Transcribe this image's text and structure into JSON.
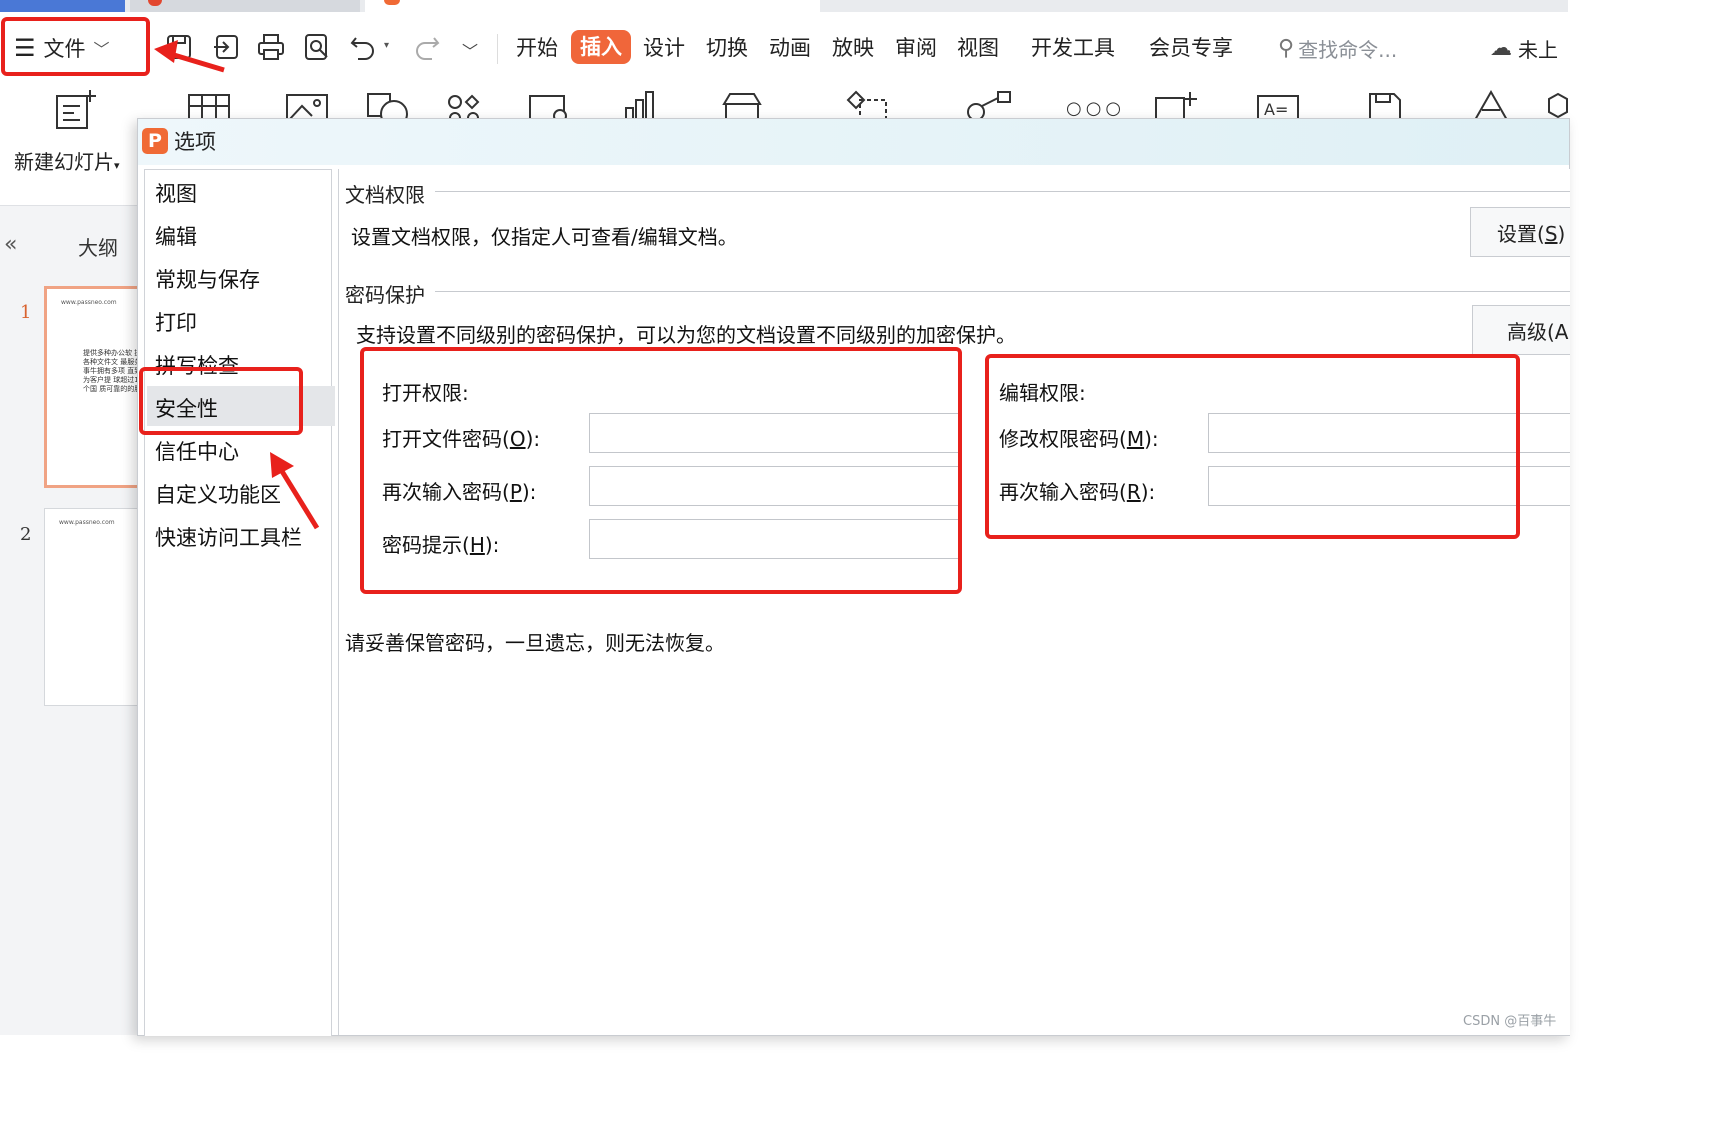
{
  "toolbar": {
    "file_label": "文件",
    "menu_tabs": [
      "开始",
      "插入",
      "设计",
      "切换",
      "动画",
      "放映",
      "审阅",
      "视图",
      "开发工具",
      "会员专享"
    ],
    "search_placeholder": "查找命令...",
    "cloud_label": "未上"
  },
  "ribbon": {
    "new_slide_label": "新建幻灯片"
  },
  "left_panel": {
    "outline_label": "大纲",
    "slides": [
      {
        "number": "1",
        "url": "www.passneo.com",
        "text": "提供多种办公软 提供各种文件文 最服务 百事牛拥有多项 直致力为客户提 球超过160个国 质可靠的的服务"
      },
      {
        "number": "2",
        "url": "www.passneo.com",
        "text": ""
      }
    ]
  },
  "dialog": {
    "title": "选项",
    "nav_items": [
      "视图",
      "编辑",
      "常规与保存",
      "打印",
      "拼写检查",
      "安全性",
      "信任中心",
      "自定义功能区",
      "快速访问工具栏"
    ],
    "selected_nav": "安全性",
    "doc_permission": {
      "title": "文档权限",
      "desc": "设置文档权限，仅指定人可查看/编辑文档。",
      "button": "设置(S)"
    },
    "password_protection": {
      "title": "密码保护",
      "desc": "支持设置不同级别的密码保护，可以为您的文档设置不同级别的加密保护。",
      "advanced_button": "高级(A",
      "open_permission": {
        "title": "打开权限:",
        "open_password_label": "打开文件密码(O):",
        "confirm_password_label": "再次输入密码(P):",
        "hint_label": "密码提示(H):"
      },
      "edit_permission": {
        "title": "编辑权限:",
        "modify_password_label": "修改权限密码(M):",
        "confirm_password_label": "再次输入密码(R):"
      }
    },
    "note": "请妥善保管密码，一旦遗忘，则无法恢复。"
  },
  "watermark": "CSDN @百事牛",
  "colors": {
    "accent": "#f0663a",
    "annotation_red": "#e8211c"
  }
}
